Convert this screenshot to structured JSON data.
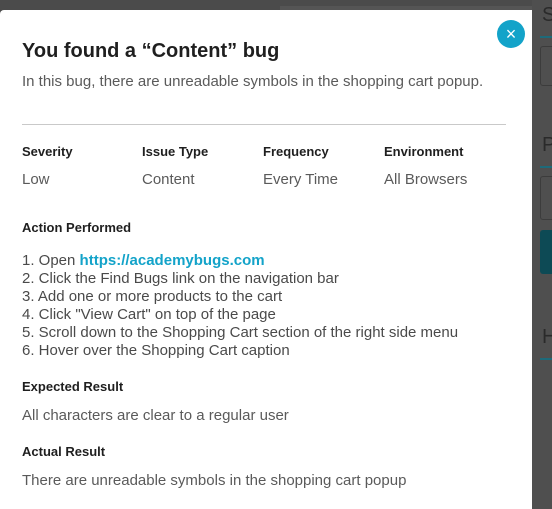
{
  "modal": {
    "title": "You found a “Content” bug",
    "description": "In this bug, there are unreadable symbols in the shopping cart popup.",
    "close_icon": "close-icon",
    "close_symbol": "×"
  },
  "attributes": [
    {
      "label": "Severity",
      "value": "Low"
    },
    {
      "label": "Issue Type",
      "value": "Content"
    },
    {
      "label": "Frequency",
      "value": "Every Time"
    },
    {
      "label": "Environment",
      "value": "All Browsers"
    }
  ],
  "action": {
    "label": "Action Performed",
    "steps": [
      {
        "prefix": "1. Open ",
        "link": "https://academybugs.com"
      },
      {
        "text": "2. Click the Find Bugs link on the navigation bar"
      },
      {
        "text": "3. Add one or more products to the cart"
      },
      {
        "text": "4. Click \"View Cart\" on top of the page"
      },
      {
        "text": "5. Scroll down to the Shopping Cart section of the right side menu"
      },
      {
        "text": "6. Hover over the Shopping Cart caption"
      }
    ]
  },
  "expected": {
    "label": "Expected Result",
    "text": "All characters are clear to a regular user"
  },
  "actual": {
    "label": "Actual Result",
    "text": "There are unreadable symbols in the shopping cart popup"
  },
  "background": {
    "letters": [
      "S",
      "P",
      "H"
    ]
  },
  "colors": {
    "accent": "#13a3c9",
    "overlay": "#4b4b4b"
  }
}
